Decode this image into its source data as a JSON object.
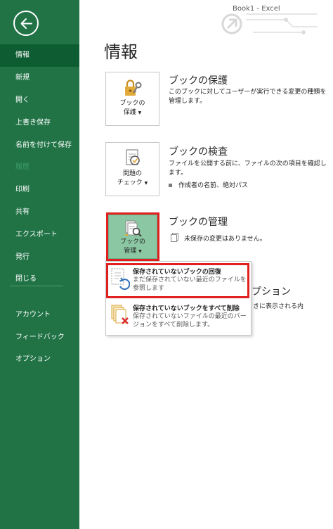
{
  "window": {
    "title": "Book1  -  Excel"
  },
  "sidebar": {
    "back_label": "戻る",
    "items": [
      {
        "label": "情報",
        "active": true
      },
      {
        "label": "新規"
      },
      {
        "label": "開く"
      },
      {
        "label": "上書き保存"
      },
      {
        "label": "名前を付けて保存"
      },
      {
        "label": "履歴",
        "disabled": true
      },
      {
        "label": "印刷"
      },
      {
        "label": "共有"
      },
      {
        "label": "エクスポート"
      },
      {
        "label": "発行"
      },
      {
        "label": "閉じる"
      },
      {
        "label": "アカウント"
      },
      {
        "label": "フィードバック"
      },
      {
        "label": "オプション"
      }
    ]
  },
  "main": {
    "title": "情報",
    "protect": {
      "button_line1": "ブックの",
      "button_line2": "保護",
      "title": "ブックの保護",
      "desc": "このブックに対してユーザーが実行できる変更の種類を管理します。"
    },
    "inspect": {
      "button_line1": "問題の",
      "button_line2": "チェック",
      "title": "ブックの検査",
      "desc": "ファイルを公開する前に、ファイルの次の項目を確認します。",
      "bullet": "作成者の名前、絶対パス"
    },
    "manage": {
      "button_line1": "ブックの",
      "button_line2": "管理",
      "title": "ブックの管理",
      "status": "未保存の変更はありません。"
    },
    "options_peek": {
      "title_fragment": "プション",
      "desc_fragment": "きに表示される内"
    }
  },
  "dropdown": {
    "items": [
      {
        "title": "保存されていないブックの回復",
        "desc": "まだ保存されていない最近のファイルを参照します"
      },
      {
        "title": "保存されていないブックをすべて削除",
        "desc": "保存されていないファイルの最近のバージョンをすべて削除します。"
      }
    ]
  },
  "colors": {
    "sidebar_bg": "#217346",
    "sidebar_active": "#0e5c32",
    "highlight_red": "#e0201f",
    "manage_tile_bg": "#8bc7a2"
  }
}
